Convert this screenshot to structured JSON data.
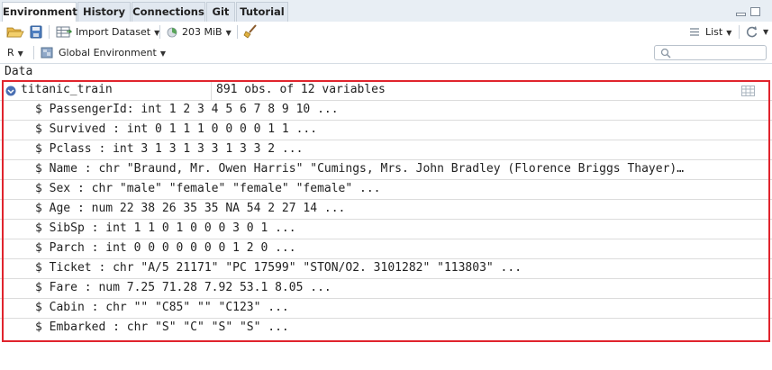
{
  "tabs": [
    {
      "label": "Environment",
      "active": true
    },
    {
      "label": "History",
      "active": false
    },
    {
      "label": "Connections",
      "active": false
    },
    {
      "label": "Git",
      "active": false
    },
    {
      "label": "Tutorial",
      "active": false
    }
  ],
  "toolbar": {
    "import_dataset_label": "Import Dataset",
    "memory_label": "203 MiB",
    "view_mode_label": "List"
  },
  "env_bar": {
    "language_label": "R",
    "scope_label": "Global Environment",
    "search_placeholder": ""
  },
  "section_header": "Data",
  "object": {
    "name": "titanic_train",
    "summary": "891 obs. of 12 variables"
  },
  "variables": [
    "$ PassengerId: int  1 2 3 4 5 6 7 8 9 10 ...",
    "$ Survived   : int  0 1 1 1 0 0 0 0 1 1 ...",
    "$ Pclass     : int  3 1 3 1 3 3 1 3 3 2 ...",
    "$ Name       : chr  \"Braund, Mr. Owen Harris\" \"Cumings, Mrs. John Bradley (Florence Briggs Thayer)…",
    "$ Sex        : chr  \"male\" \"female\" \"female\" \"female\" ...",
    "$ Age        : num  22 38 26 35 35 NA 54 2 27 14 ...",
    "$ SibSp      : int  1 1 0 1 0 0 0 3 0 1 ...",
    "$ Parch      : int  0 0 0 0 0 0 0 1 2 0 ...",
    "$ Ticket     : chr  \"A/5 21171\" \"PC 17599\" \"STON/O2. 3101282\" \"113803\" ...",
    "$ Fare       : num  7.25 71.28 7.92 53.1 8.05 ...",
    "$ Cabin      : chr  \"\" \"C85\" \"\" \"C123\" ...",
    "$ Embarked   : chr  \"S\" \"C\" \"S\" \"S\" ..."
  ],
  "colors": {
    "highlight": "#e0242d",
    "expand_icon": "#4a6fb3"
  }
}
